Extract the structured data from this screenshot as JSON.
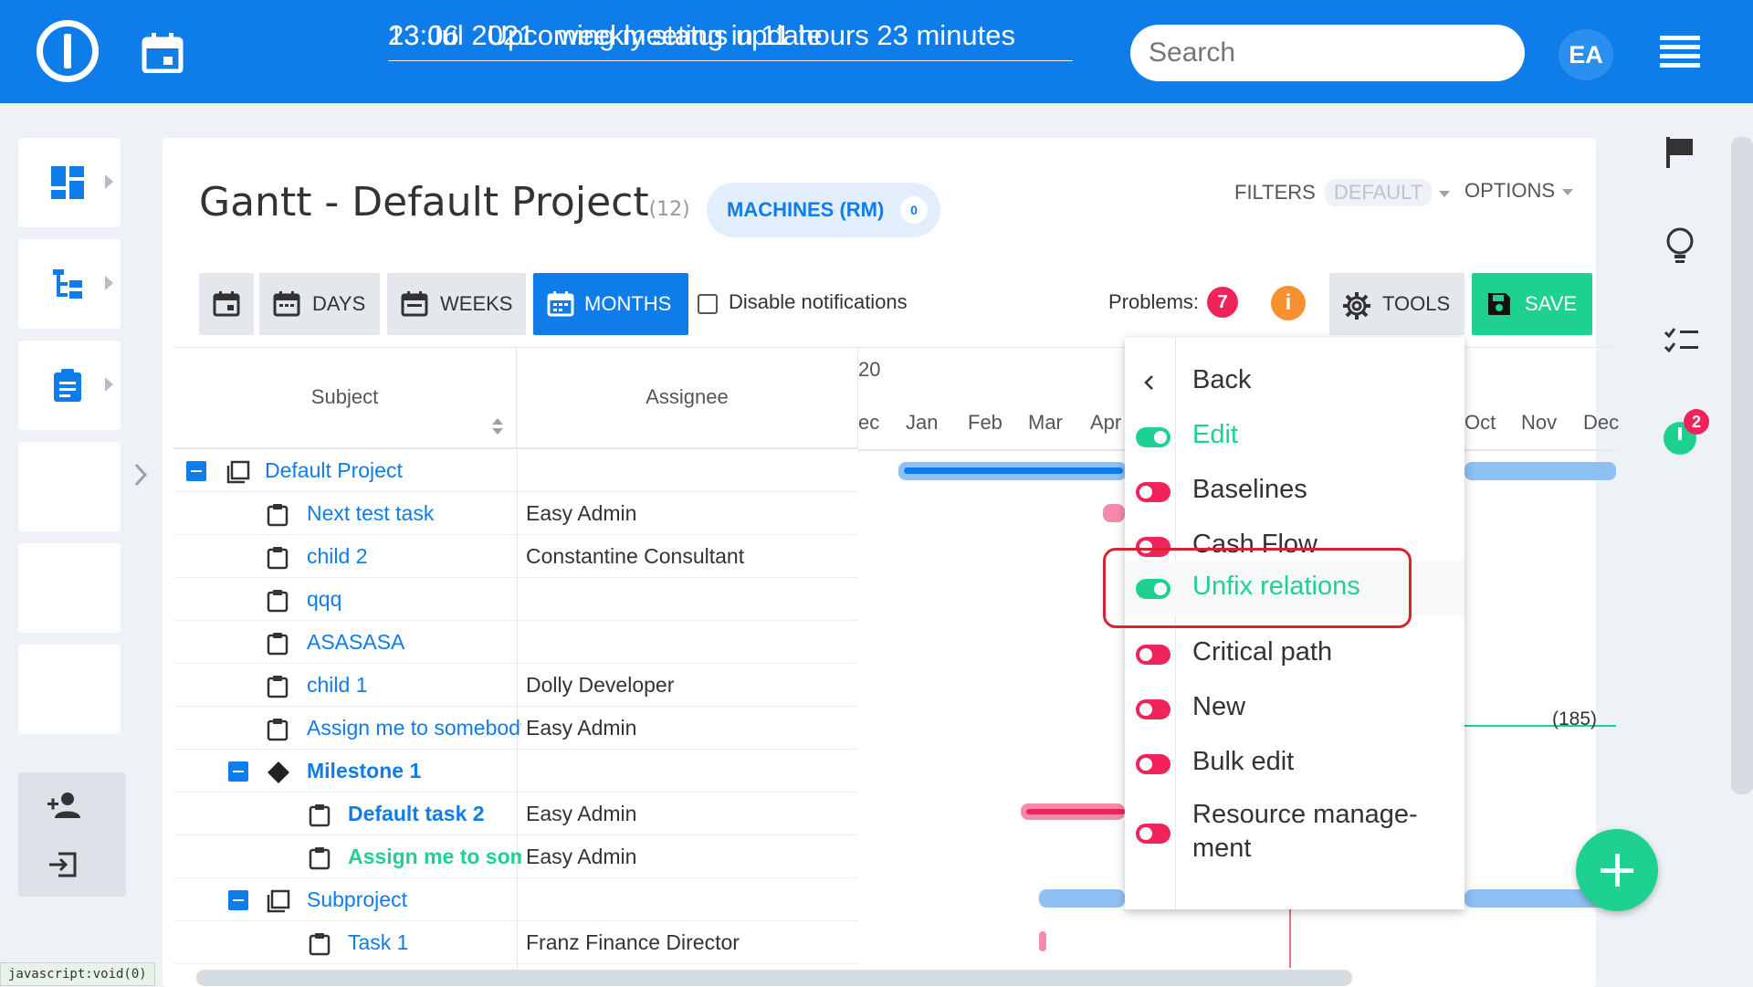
{
  "topbar": {
    "time": "23:06",
    "meeting_text": "Upcoming meeting in 11 hours 23 minutes",
    "date": "13 Jul 2021",
    "meeting_title": "weekly status update",
    "search_placeholder": "Search",
    "avatar_initials": "EA"
  },
  "page": {
    "title": "Gantt - Default Project",
    "count": "(12)",
    "machines_label": "MACHINES (RM)",
    "machines_count": "0",
    "filters_label": "FILTERS",
    "filters_value": "DEFAULT",
    "options_label": "OPTIONS"
  },
  "toolbar": {
    "days": "DAYS",
    "weeks": "WEEKS",
    "months": "MONTHS",
    "disable_notifications": "Disable notifications",
    "problems_label": "Problems:",
    "problems_count": "7",
    "info_icon": "i",
    "tools": "TOOLS",
    "save": "SAVE"
  },
  "table": {
    "headers": {
      "subject": "Subject",
      "assignee": "Assignee"
    },
    "rows": [
      {
        "subject": "Default Project",
        "assignee": ""
      },
      {
        "subject": "Next test task",
        "assignee": "Easy Admin"
      },
      {
        "subject": "child 2",
        "assignee": "Constantine Consultant"
      },
      {
        "subject": "qqq",
        "assignee": ""
      },
      {
        "subject": "ASASASA",
        "assignee": ""
      },
      {
        "subject": "child 1",
        "assignee": "Dolly Developer"
      },
      {
        "subject": "Assign me to somebody",
        "assignee": "Easy Admin"
      },
      {
        "subject": "Milestone 1",
        "assignee": ""
      },
      {
        "subject": "Default task 2",
        "assignee": "Easy Admin"
      },
      {
        "subject": "Assign me to somebody",
        "assignee": "Easy Admin"
      },
      {
        "subject": "Subproject",
        "assignee": ""
      },
      {
        "subject": "Task 1",
        "assignee": "Franz Finance Director"
      }
    ]
  },
  "timeline": {
    "year": "20",
    "months": [
      "ec",
      "Jan",
      "Feb",
      "Mar",
      "Apr",
      "Oct",
      "Nov",
      "Dec"
    ],
    "annotation": "(185)"
  },
  "tools_menu": {
    "back": "Back",
    "items": [
      {
        "label": "Edit",
        "state": "on"
      },
      {
        "label": "Baselines",
        "state": "off"
      },
      {
        "label": "Cash Flow",
        "state": "off"
      },
      {
        "label": "Unfix relations",
        "state": "on"
      },
      {
        "label": "Critical path",
        "state": "off"
      },
      {
        "label": "New",
        "state": "off"
      },
      {
        "label": "Bulk edit",
        "state": "off"
      },
      {
        "label": "Resource manage-ment",
        "state": "off"
      }
    ]
  },
  "right_sidebar": {
    "timer_badge": "2"
  },
  "statusbar": {
    "text": "javascript:void(0)"
  },
  "colors": {
    "brand": "#0f7de9",
    "success": "#1fd191",
    "danger": "#f0245a",
    "warning": "#f7902f",
    "highlight": "#d9232e"
  }
}
